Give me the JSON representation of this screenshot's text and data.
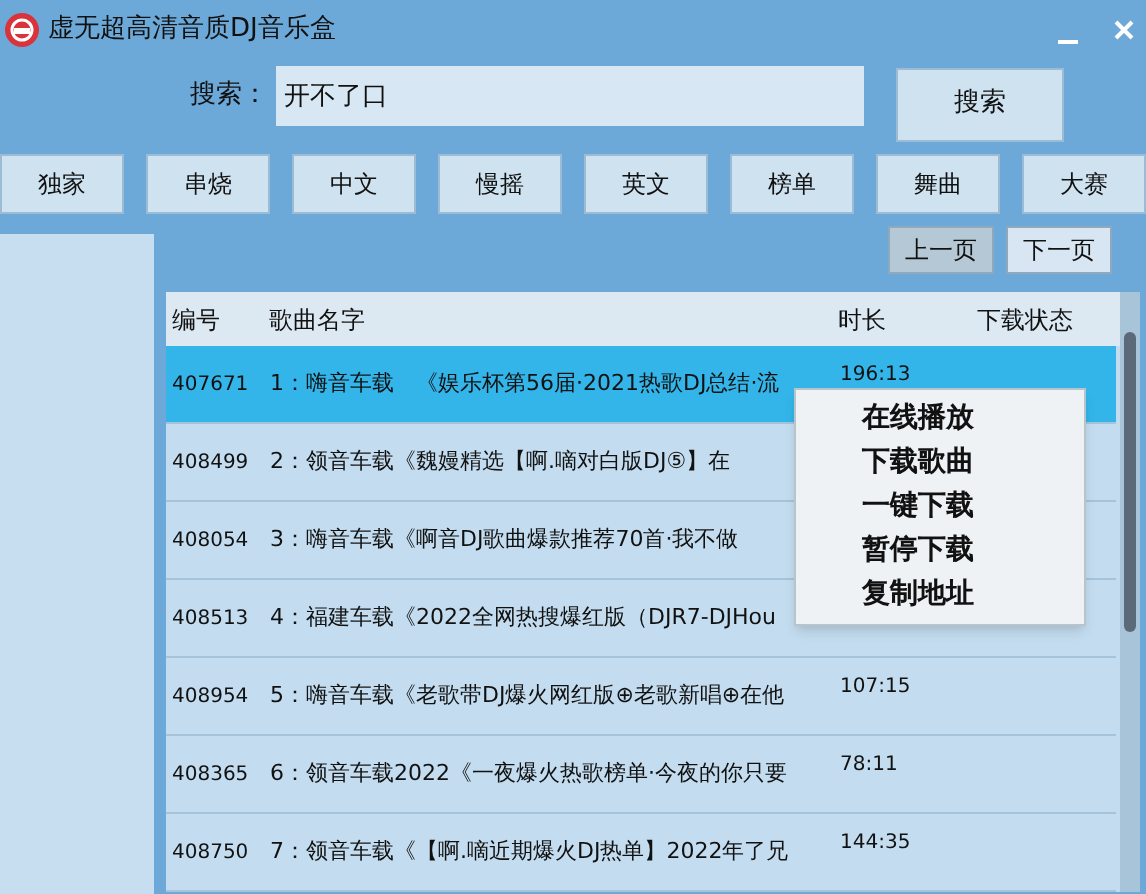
{
  "window": {
    "title": "虚无超高清音质DJ音乐盒"
  },
  "search": {
    "label": "搜索：",
    "value": "开不了口",
    "button": "搜索"
  },
  "categories": [
    {
      "label": "独家",
      "selected": false
    },
    {
      "label": "串烧",
      "selected": false
    },
    {
      "label": "中文",
      "selected": false
    },
    {
      "label": "慢摇",
      "selected": false
    },
    {
      "label": "英文",
      "selected": false
    },
    {
      "label": "榜单",
      "selected": false
    },
    {
      "label": "舞曲",
      "selected": false
    },
    {
      "label": "大赛",
      "selected": false
    }
  ],
  "pager": {
    "prev": "上一页",
    "next": "下一页"
  },
  "table": {
    "columns": [
      "编号",
      "歌曲名字",
      "时长",
      "下载状态"
    ],
    "rows": [
      {
        "id": "407671",
        "name": "1：嗨音车载　《娱乐杯第56届·2021热歌DJ总结·流",
        "duration": "196:13",
        "selected": true
      },
      {
        "id": "408499",
        "name": "2：领音车载《魏嫚精选【啊.嘀对白版DJ⑤】在",
        "duration": "",
        "selected": false
      },
      {
        "id": "408054",
        "name": "3：嗨音车载《啊音DJ歌曲爆款推荐70首·我不做",
        "duration": "",
        "selected": false
      },
      {
        "id": "408513",
        "name": "4：福建车载《2022全网热搜爆红版（DJR7-DJHou",
        "duration": "",
        "selected": false
      },
      {
        "id": "408954",
        "name": "5：嗨音车载《老歌带DJ爆火网红版⊕老歌新唱⊕在他",
        "duration": "107:15",
        "selected": false
      },
      {
        "id": "408365",
        "name": "6：领音车载2022《一夜爆火热歌榜单·今夜的你只要",
        "duration": "78:11",
        "selected": false
      },
      {
        "id": "408750",
        "name": "7：领音车载《【啊.嘀近期爆火DJ热单】2022年了兄",
        "duration": "144:35",
        "selected": false
      }
    ]
  },
  "context_menu": [
    "在线播放",
    "下载歌曲",
    "一键下载",
    "暂停下载",
    "复制地址"
  ]
}
